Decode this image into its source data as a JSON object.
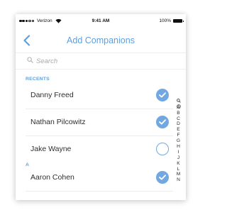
{
  "status_bar": {
    "carrier": "Verizon",
    "time": "9:41 AM",
    "battery": "100%"
  },
  "nav": {
    "title": "Add Companions",
    "back_icon": "chevron-left-icon"
  },
  "search": {
    "placeholder": "Search",
    "icon": "search-icon"
  },
  "sections": [
    {
      "header": "RECENTS",
      "rows": [
        {
          "name": "Danny Freed",
          "selected": true
        },
        {
          "name": "Nathan Pilcowitz",
          "selected": true
        },
        {
          "name": "Jake Wayne",
          "selected": false
        }
      ]
    },
    {
      "header": "A",
      "rows": [
        {
          "name": "Aaron Cohen",
          "selected": true
        }
      ]
    }
  ],
  "index": {
    "icons": [
      "search-icon",
      "clock-icon"
    ],
    "letters": [
      "A",
      "B",
      "C",
      "D",
      "E",
      "F",
      "G",
      "H",
      "I",
      "J",
      "K",
      "L",
      "M",
      "N"
    ]
  },
  "colors": {
    "accent": "#5d9fdf",
    "check_fill": "#72a8e2",
    "text": "#2e2e2e",
    "placeholder": "#aaaaaa"
  }
}
